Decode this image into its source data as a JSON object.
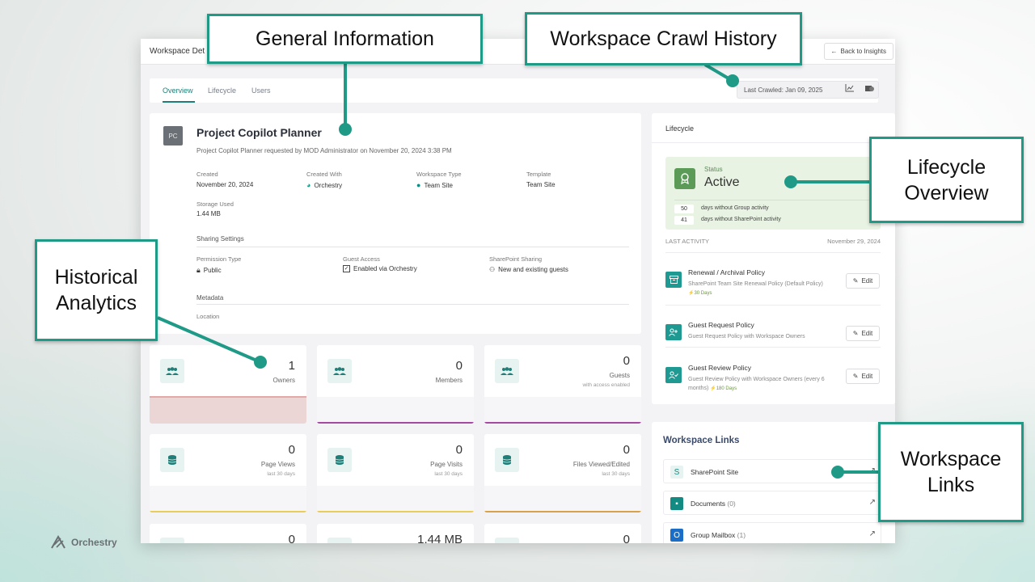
{
  "app": {
    "title": "Workspace Det",
    "back_button": "Back to Insights"
  },
  "tabs": [
    "Overview",
    "Lifecycle",
    "Users"
  ],
  "crawl": {
    "last_crawled": "Last Crawled: Jan 09, 2025"
  },
  "general": {
    "avatar": "PC",
    "title": "Project Copilot Planner",
    "subtitle": "Project Copilot Planner requested by MOD Administrator on November 20, 2024 3:38 PM",
    "created_label": "Created",
    "created_value": "November 20, 2024",
    "created_with_label": "Created With",
    "created_with_value": "Orchestry",
    "type_label": "Workspace Type",
    "type_value": "Team Site",
    "template_label": "Template",
    "template_value": "Team Site",
    "storage_label": "Storage Used",
    "storage_value": "1.44 MB",
    "sharing_heading": "Sharing Settings",
    "permission_label": "Permission Type",
    "permission_value": "Public",
    "guest_label": "Guest Access",
    "guest_value": "Enabled via Orchestry",
    "sp_sharing_label": "SharePoint Sharing",
    "sp_sharing_value": "New and existing guests",
    "metadata_heading": "Metadata",
    "location_label": "Location"
  },
  "stats": [
    {
      "value": "1",
      "label": "Owners",
      "sub": "",
      "icon": "people-icon"
    },
    {
      "value": "0",
      "label": "Members",
      "sub": "",
      "icon": "people-icon"
    },
    {
      "value": "0",
      "label": "Guests",
      "sub": "with access enabled",
      "icon": "people-icon"
    },
    {
      "value": "0",
      "label": "Page Views",
      "sub": "last 30 days",
      "icon": "database-icon"
    },
    {
      "value": "0",
      "label": "Page Visits",
      "sub": "last 30 days",
      "icon": "database-icon"
    },
    {
      "value": "0",
      "label": "Files Viewed/Edited",
      "sub": "last 30 days",
      "icon": "database-icon"
    },
    {
      "value": "0",
      "label": "",
      "sub": "",
      "icon": "database-icon"
    },
    {
      "value": "1.44 MB",
      "label": "",
      "sub": "",
      "icon": "database-icon"
    },
    {
      "value": "0",
      "label": "",
      "sub": "",
      "icon": "database-icon"
    }
  ],
  "lifecycle": {
    "heading": "Lifecycle",
    "status_label": "Status",
    "status_value": "Active",
    "group_days": "50",
    "group_text": "days without Group activity",
    "sp_days": "41",
    "sp_text": "days without SharePoint activity",
    "last_activity_label": "LAST ACTIVITY",
    "last_activity_value": "November 29, 2024",
    "policies": [
      {
        "title": "Renewal / Archival Policy",
        "desc": "SharePoint Team Site Renewal Policy (Default Policy)",
        "badge": "⚡30 Days",
        "edit": "Edit"
      },
      {
        "title": "Guest Request Policy",
        "desc": "Guest Request Policy with Workspace Owners",
        "badge": "",
        "edit": "Edit"
      },
      {
        "title": "Guest Review Policy",
        "desc": "Guest Review Policy with Workspace Owners (every 6 months)",
        "badge": "⚡180 Days",
        "edit": "Edit"
      }
    ]
  },
  "links": {
    "heading": "Workspace Links",
    "items": [
      {
        "label": "SharePoint Site",
        "count": ""
      },
      {
        "label": "Documents",
        "count": "(0)"
      },
      {
        "label": "Group Mailbox",
        "count": "(1)"
      }
    ]
  },
  "callouts": {
    "general": "General Information",
    "crawl": "Workspace Crawl History",
    "lifecycle": "Lifecycle\nOverview",
    "historical": "Historical\nAnalytics",
    "links": "Workspace\nLinks"
  },
  "brand": {
    "name": "Orchestry",
    "accent": "#1f9a86"
  },
  "stat_line_colors": [
    "#e7b5b5",
    "#a44aa0",
    "#a44aa0",
    "#e8cd5a",
    "#e8cd5a",
    "#d8a24a"
  ]
}
